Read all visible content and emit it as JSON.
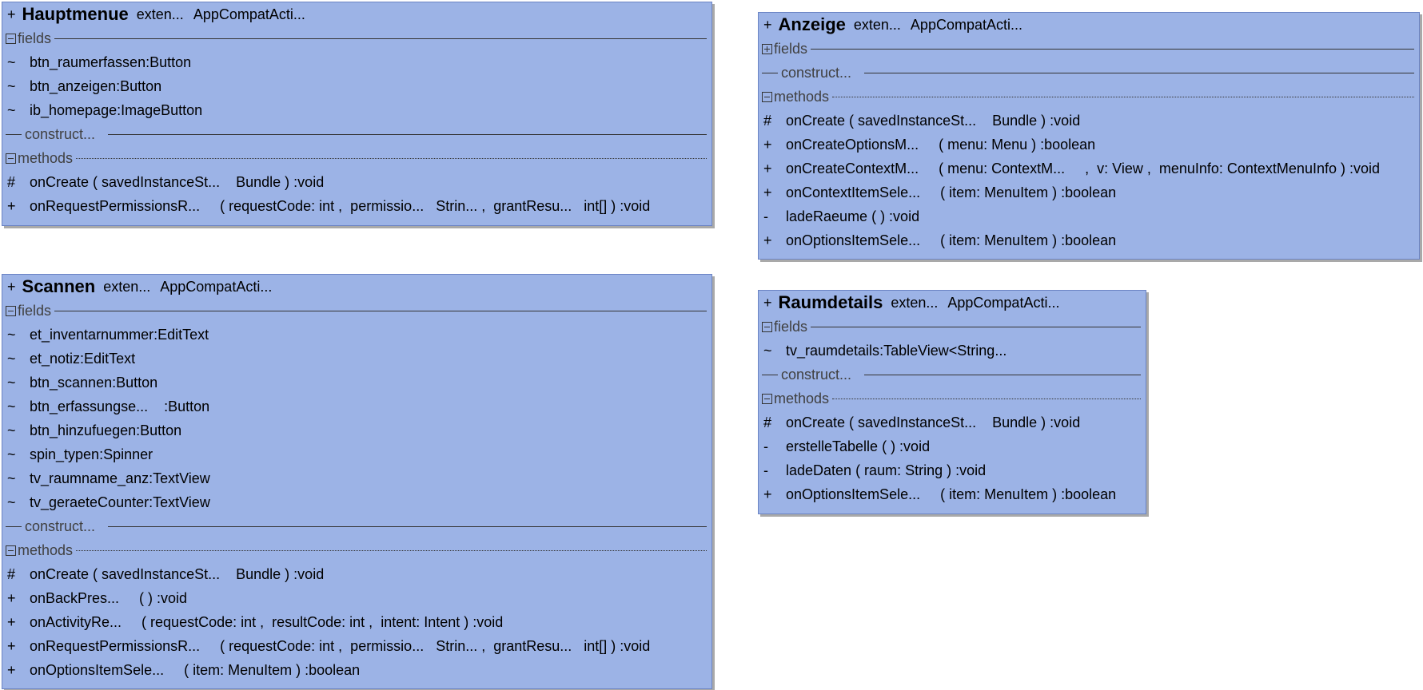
{
  "classes": {
    "hauptmenue": {
      "vis": "+",
      "name": "Hauptmenue",
      "extends_kw": "exten...",
      "parent": "AppCompatActi...",
      "fields_label": "fields",
      "construct_label": "construct...",
      "methods_label": "methods",
      "fields": [
        {
          "vis": "~",
          "name": "btn_raumerfassen",
          "type": ":Button"
        },
        {
          "vis": "~",
          "name": "btn_anzeigen",
          "type": ":Button"
        },
        {
          "vis": "~",
          "name": "ib_homepage",
          "type": ":ImageButton"
        }
      ],
      "methods": [
        {
          "vis": "#",
          "sig": "onCreate ( savedInstanceSt...    Bundle ) :void"
        },
        {
          "vis": "+",
          "sig": "onRequestPermissionsR...     ( requestCode: int ,  permissio...   Strin... ,  grantResu...   int[] ) :void"
        }
      ]
    },
    "anzeige": {
      "vis": "+",
      "name": "Anzeige",
      "extends_kw": "exten...",
      "parent": "AppCompatActi...",
      "fields_label": "fields",
      "construct_label": "construct...",
      "methods_label": "methods",
      "methods": [
        {
          "vis": "#",
          "sig": "onCreate ( savedInstanceSt...    Bundle ) :void"
        },
        {
          "vis": "+",
          "sig": "onCreateOptionsM...     ( menu: Menu ) :boolean"
        },
        {
          "vis": "+",
          "sig": "onCreateContextM...     ( menu: ContextM...     ,  v: View ,  menuInfo: ContextMenuInfo ) :void"
        },
        {
          "vis": "+",
          "sig": "onContextItemSele...     ( item: MenuItem ) :boolean"
        },
        {
          "vis": "-",
          "sig": "ladeRaeume ( ) :void"
        },
        {
          "vis": "+",
          "sig": "onOptionsItemSele...     ( item: MenuItem ) :boolean"
        }
      ]
    },
    "scannen": {
      "vis": "+",
      "name": "Scannen",
      "extends_kw": "exten...",
      "parent": "AppCompatActi...",
      "fields_label": "fields",
      "construct_label": "construct...",
      "methods_label": "methods",
      "fields": [
        {
          "vis": "~",
          "name": "et_inventarnummer",
          "type": ":EditText"
        },
        {
          "vis": "~",
          "name": "et_notiz",
          "type": ":EditText"
        },
        {
          "vis": "~",
          "name": "btn_scannen",
          "type": ":Button"
        },
        {
          "vis": "~",
          "name": "btn_erfassungse...",
          "type": "    :Button"
        },
        {
          "vis": "~",
          "name": "btn_hinzufuegen",
          "type": ":Button"
        },
        {
          "vis": "~",
          "name": "spin_typen",
          "type": ":Spinner"
        },
        {
          "vis": "~",
          "name": "tv_raumname_anz",
          "type": ":TextView"
        },
        {
          "vis": "~",
          "name": "tv_geraeteCounter",
          "type": ":TextView"
        }
      ],
      "methods": [
        {
          "vis": "#",
          "sig": "onCreate ( savedInstanceSt...    Bundle ) :void"
        },
        {
          "vis": "+",
          "sig": "onBackPres...     ( ) :void"
        },
        {
          "vis": "+",
          "sig": "onActivityRe...     ( requestCode: int ,  resultCode: int ,  intent: Intent ) :void"
        },
        {
          "vis": "+",
          "sig": "onRequestPermissionsR...     ( requestCode: int ,  permissio...   Strin... ,  grantResu...   int[] ) :void"
        },
        {
          "vis": "+",
          "sig": "onOptionsItemSele...     ( item: MenuItem ) :boolean"
        }
      ]
    },
    "raumdetails": {
      "vis": "+",
      "name": "Raumdetails",
      "extends_kw": "exten...",
      "parent": "AppCompatActi...",
      "fields_label": "fields",
      "construct_label": "construct...",
      "methods_label": "methods",
      "fields": [
        {
          "vis": "~",
          "name": "tv_raumdetails",
          "type": ":TableView<String..."
        }
      ],
      "methods": [
        {
          "vis": "#",
          "sig": "onCreate ( savedInstanceSt...    Bundle ) :void"
        },
        {
          "vis": "-",
          "sig": "erstelleTabelle ( ) :void"
        },
        {
          "vis": "-",
          "sig": "ladeDaten ( raum: String ) :void"
        },
        {
          "vis": "+",
          "sig": "onOptionsItemSele...     ( item: MenuItem ) :boolean"
        }
      ]
    }
  }
}
